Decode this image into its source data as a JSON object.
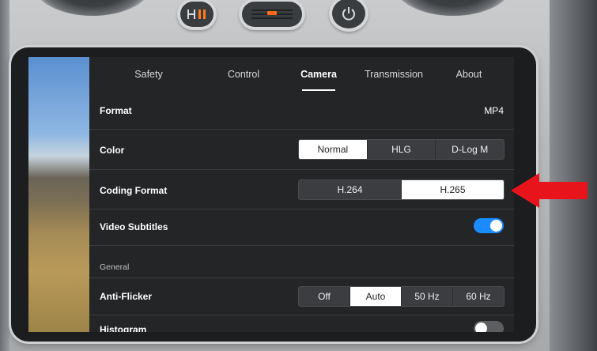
{
  "tabs": [
    {
      "label": "Safety",
      "active": false
    },
    {
      "label": "Control",
      "active": false
    },
    {
      "label": "Camera",
      "active": true
    },
    {
      "label": "Transmission",
      "active": false
    },
    {
      "label": "About",
      "active": false
    }
  ],
  "rows": {
    "format": {
      "label": "Format",
      "value": "MP4"
    },
    "color": {
      "label": "Color",
      "options": [
        "Normal",
        "HLG",
        "D-Log M"
      ],
      "selected": "Normal"
    },
    "coding_format": {
      "label": "Coding Format",
      "options": [
        "H.264",
        "H.265"
      ],
      "selected": "H.265"
    },
    "video_subtitles": {
      "label": "Video Subtitles",
      "enabled": true
    },
    "general_section": "General",
    "anti_flicker": {
      "label": "Anti-Flicker",
      "options": [
        "Off",
        "Auto",
        "50 Hz",
        "60 Hz"
      ],
      "selected": "Auto"
    },
    "histogram": {
      "label": "Histogram",
      "enabled": false
    }
  },
  "colors": {
    "toggle_on": "#1a8cff",
    "toggle_off": "#5c5e61",
    "arrow": "#e8141b",
    "record_indicator": "#ff6a1a",
    "pause_indicator": "#ff7a1a"
  },
  "icons": {
    "hardware_left_button": "pause-return-icon",
    "hardware_center_button": "record-icon",
    "hardware_right_button": "power-icon"
  }
}
